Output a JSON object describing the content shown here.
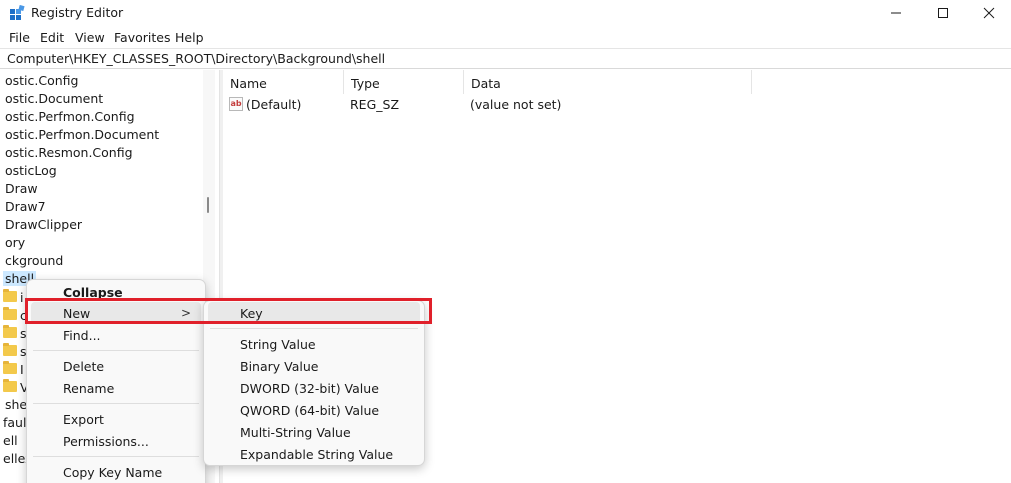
{
  "window": {
    "title": "Registry Editor",
    "controls": {
      "minimize_icon": "minimize-icon",
      "maximize_icon": "maximize-icon",
      "close_icon": "close-icon"
    }
  },
  "menubar": {
    "items": [
      "File",
      "Edit",
      "View",
      "Favorites",
      "Help"
    ]
  },
  "address": {
    "path": "Computer\\HKEY_CLASSES_ROOT\\Directory\\Background\\shell"
  },
  "tree": {
    "items": [
      {
        "label": "ostic.Config"
      },
      {
        "label": "ostic.Document"
      },
      {
        "label": "ostic.Perfmon.Config"
      },
      {
        "label": "ostic.Perfmon.Document"
      },
      {
        "label": "ostic.Resmon.Config"
      },
      {
        "label": "osticLog"
      },
      {
        "label": "Draw"
      },
      {
        "label": "Draw7"
      },
      {
        "label": "DrawClipper"
      },
      {
        "label": "ory"
      },
      {
        "label": "ckground"
      },
      {
        "label": "shell"
      }
    ],
    "folder_rows": [
      {
        "label": "i"
      },
      {
        "label": "c"
      },
      {
        "label": "s"
      },
      {
        "label": "s"
      },
      {
        "label": "I"
      },
      {
        "label": "V"
      }
    ],
    "tail_items": [
      {
        "label": "she"
      },
      {
        "label": "faul"
      },
      {
        "label": "ell"
      },
      {
        "label": "ellex"
      }
    ]
  },
  "list": {
    "columns": [
      "Name",
      "Type",
      "Data"
    ],
    "rows": [
      {
        "name": "(Default)",
        "type": "REG_SZ",
        "data": "(value not set)",
        "icon": "ab-string-icon"
      }
    ]
  },
  "context_menu": {
    "items": {
      "collapse": "Collapse",
      "new": "New",
      "find": "Find...",
      "delete": "Delete",
      "rename": "Rename",
      "export": "Export",
      "permissions": "Permissions...",
      "copy_key_name": "Copy Key Name"
    },
    "submenu_arrow": ">"
  },
  "submenu": {
    "items": {
      "key": "Key",
      "string_value": "String Value",
      "binary_value": "Binary Value",
      "dword_value": "DWORD (32-bit) Value",
      "qword_value": "QWORD (64-bit) Value",
      "multi_string_value": "Multi-String Value",
      "expandable_string_value": "Expandable String Value"
    }
  },
  "colors": {
    "highlight_border": "#e0202a",
    "selection": "#cce8ff",
    "folder": "#f3c94b"
  }
}
